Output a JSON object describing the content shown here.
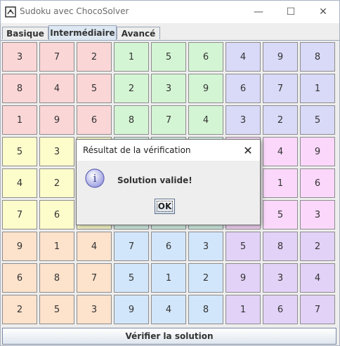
{
  "window": {
    "title": "Sudoku avec ChocoSolver",
    "minimize_glyph": "—",
    "maximize_glyph": "☐",
    "close_glyph": "✕"
  },
  "tabs": [
    {
      "label": "Basique",
      "active": false
    },
    {
      "label": "Intermédiaire",
      "active": true
    },
    {
      "label": "Avancé",
      "active": false
    }
  ],
  "grid": {
    "rows": [
      [
        "3",
        "7",
        "2",
        "1",
        "5",
        "6",
        "4",
        "9",
        "8"
      ],
      [
        "8",
        "4",
        "5",
        "2",
        "3",
        "9",
        "6",
        "7",
        "1"
      ],
      [
        "1",
        "9",
        "6",
        "8",
        "7",
        "4",
        "3",
        "2",
        "5"
      ],
      [
        "5",
        "3",
        "",
        "",
        "",
        "",
        "",
        "4",
        "9"
      ],
      [
        "4",
        "2",
        "",
        "",
        "",
        "",
        "",
        "1",
        "6"
      ],
      [
        "7",
        "6",
        "",
        "",
        "",
        "",
        "",
        "5",
        "3"
      ],
      [
        "9",
        "1",
        "4",
        "7",
        "6",
        "3",
        "5",
        "8",
        "2"
      ],
      [
        "6",
        "8",
        "7",
        "5",
        "1",
        "2",
        "9",
        "3",
        "4"
      ],
      [
        "2",
        "5",
        "3",
        "9",
        "4",
        "8",
        "1",
        "6",
        "7"
      ]
    ],
    "box_colors": [
      [
        "#fbd6d6",
        "#d4f5d4",
        "#d9d9f8"
      ],
      [
        "#fdfdcc",
        "#d6f3e8",
        "#fbd8fb"
      ],
      [
        "#fde2cc",
        "#d2e6fb",
        "#e2d2f7"
      ]
    ]
  },
  "verify_button": {
    "label": "Vérifier la solution"
  },
  "dialog": {
    "title": "Résultat de la vérification",
    "close_glyph": "✕",
    "message": "Solution valide!",
    "ok_label": "OK",
    "icon_glyph": "i"
  }
}
